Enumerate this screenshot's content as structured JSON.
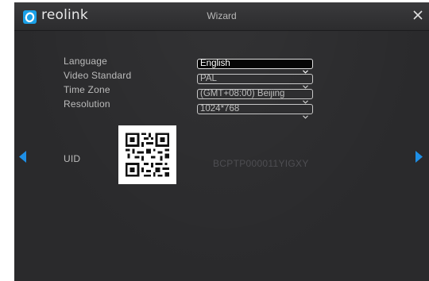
{
  "header": {
    "brand": "reolink",
    "title": "Wizard"
  },
  "form": {
    "language_label": "Language",
    "language_value": "English",
    "video_standard_label": "Video Standard",
    "video_standard_value": "PAL",
    "time_zone_label": "Time Zone",
    "time_zone_value": "(GMT+08:00) Beijing",
    "resolution_label": "Resolution",
    "resolution_value": "1024*768"
  },
  "uid": {
    "label": "UID",
    "value": "BCPTP000011YIGXY"
  },
  "icons": {
    "logo": "reolink-logo-icon",
    "close": "close-icon",
    "prev": "arrow-left-icon",
    "next": "arrow-right-icon",
    "chevron": "chevron-down-icon"
  },
  "colors": {
    "accent": "#1aa0e8",
    "background": "#2a2a2c",
    "text": "#bcbcbc"
  }
}
